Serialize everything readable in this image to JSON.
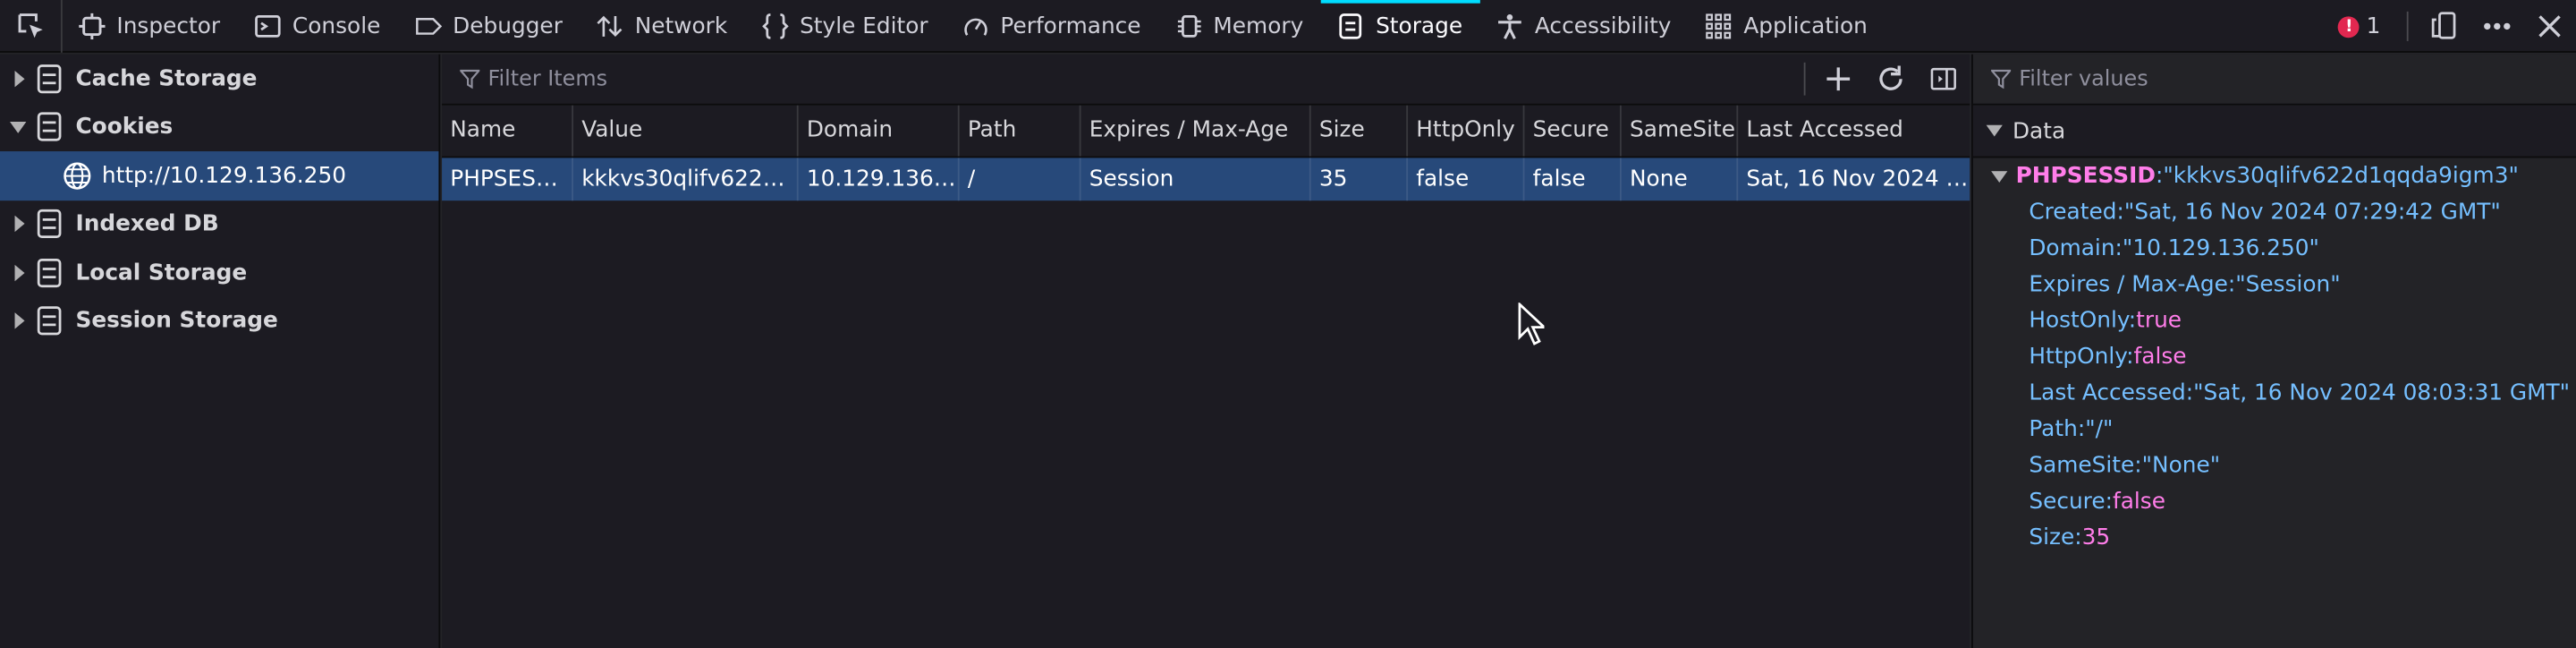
{
  "toolbar": {
    "tabs": [
      {
        "label": "Inspector",
        "icon": "inspector-icon"
      },
      {
        "label": "Console",
        "icon": "console-icon"
      },
      {
        "label": "Debugger",
        "icon": "debugger-icon"
      },
      {
        "label": "Network",
        "icon": "network-icon"
      },
      {
        "label": "Style Editor",
        "icon": "style-editor-icon"
      },
      {
        "label": "Performance",
        "icon": "performance-icon"
      },
      {
        "label": "Memory",
        "icon": "memory-icon"
      },
      {
        "label": "Storage",
        "icon": "storage-icon",
        "active": true
      },
      {
        "label": "Accessibility",
        "icon": "accessibility-icon"
      },
      {
        "label": "Application",
        "icon": "application-icon"
      }
    ],
    "error_count": "1"
  },
  "sidebar": {
    "items": [
      {
        "label": "Cache Storage"
      },
      {
        "label": "Cookies"
      },
      {
        "label": "http://10.129.136.250"
      },
      {
        "label": "Indexed DB"
      },
      {
        "label": "Local Storage"
      },
      {
        "label": "Session Storage"
      }
    ]
  },
  "table": {
    "filter_placeholder": "Filter Items",
    "columns": [
      "Name",
      "Value",
      "Domain",
      "Path",
      "Expires / Max-Age",
      "Size",
      "HttpOnly",
      "Secure",
      "SameSite",
      "Last Accessed"
    ],
    "rows": [
      [
        "PHPSESSID",
        "kkkvs30qlifv622d1qqda9igm3",
        "10.129.136.250",
        "/",
        "Session",
        "35",
        "false",
        "false",
        "None",
        "Sat, 16 Nov 2024 08:03:31 GMT"
      ]
    ]
  },
  "detail": {
    "filter_placeholder": "Filter values",
    "section_label": "Data",
    "root_name": "PHPSESSID",
    "root_value": "\"kkkvs30qlifv622d1qqda9igm3\"",
    "props": [
      {
        "key": "Created",
        "value": "\"Sat, 16 Nov 2024 07:29:42 GMT\"",
        "kind": "s"
      },
      {
        "key": "Domain",
        "value": "\"10.129.136.250\"",
        "kind": "s"
      },
      {
        "key": "Expires / Max-Age",
        "value": "\"Session\"",
        "kind": "s"
      },
      {
        "key": "HostOnly",
        "value": "true",
        "kind": "b"
      },
      {
        "key": "HttpOnly",
        "value": "false",
        "kind": "b"
      },
      {
        "key": "Last Accessed",
        "value": "\"Sat, 16 Nov 2024 08:03:31 GMT\"",
        "kind": "s"
      },
      {
        "key": "Path",
        "value": "\"/\"",
        "kind": "s"
      },
      {
        "key": "SameSite",
        "value": "\"None\"",
        "kind": "s"
      },
      {
        "key": "Secure",
        "value": "false",
        "kind": "b"
      },
      {
        "key": "Size",
        "value": "35",
        "kind": "n"
      }
    ]
  }
}
